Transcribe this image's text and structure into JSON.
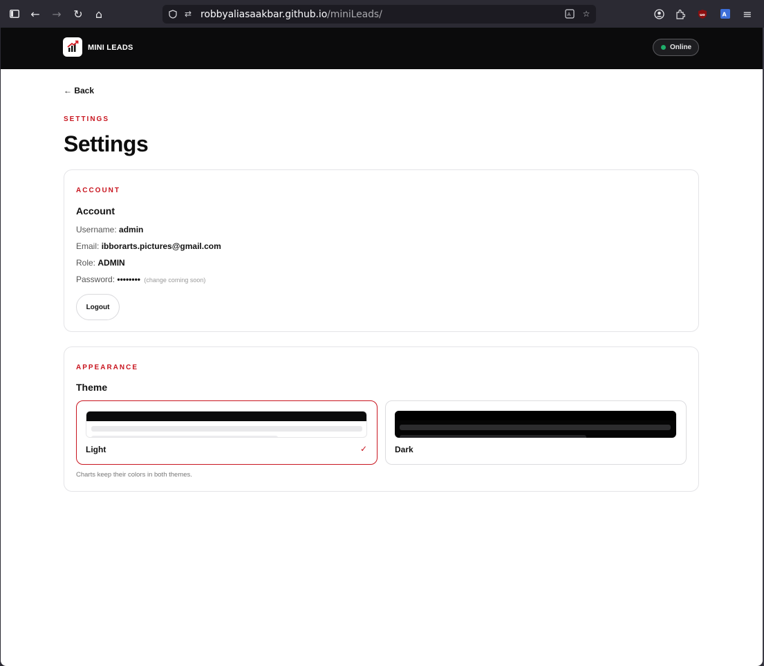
{
  "browser": {
    "url_host": "robbyaliasaakbar.github.io",
    "url_path": "/miniLeads/"
  },
  "header": {
    "brand": "MINI LEADS",
    "status": "Online"
  },
  "page": {
    "back": "← Back",
    "eyebrow": "SETTINGS",
    "title": "Settings"
  },
  "account": {
    "eyebrow": "ACCOUNT",
    "title": "Account",
    "username_label": "Username:",
    "username": "admin",
    "email_label": "Email:",
    "email": "ibborarts.pictures@gmail.com",
    "role_label": "Role:",
    "role": "ADMIN",
    "password_label": "Password:",
    "password": "••••••••",
    "password_note": "(change coming soon)",
    "logout": "Logout"
  },
  "appearance": {
    "eyebrow": "APPEARANCE",
    "title": "Theme",
    "options": [
      {
        "label": "Light",
        "selected": true
      },
      {
        "label": "Dark",
        "selected": false
      }
    ],
    "check": "✓",
    "hint": "Charts keep their colors in both themes."
  },
  "colors": {
    "accent": "#c8141e",
    "header_bg": "#0b0b0c",
    "status_dot": "#1fae6a"
  }
}
